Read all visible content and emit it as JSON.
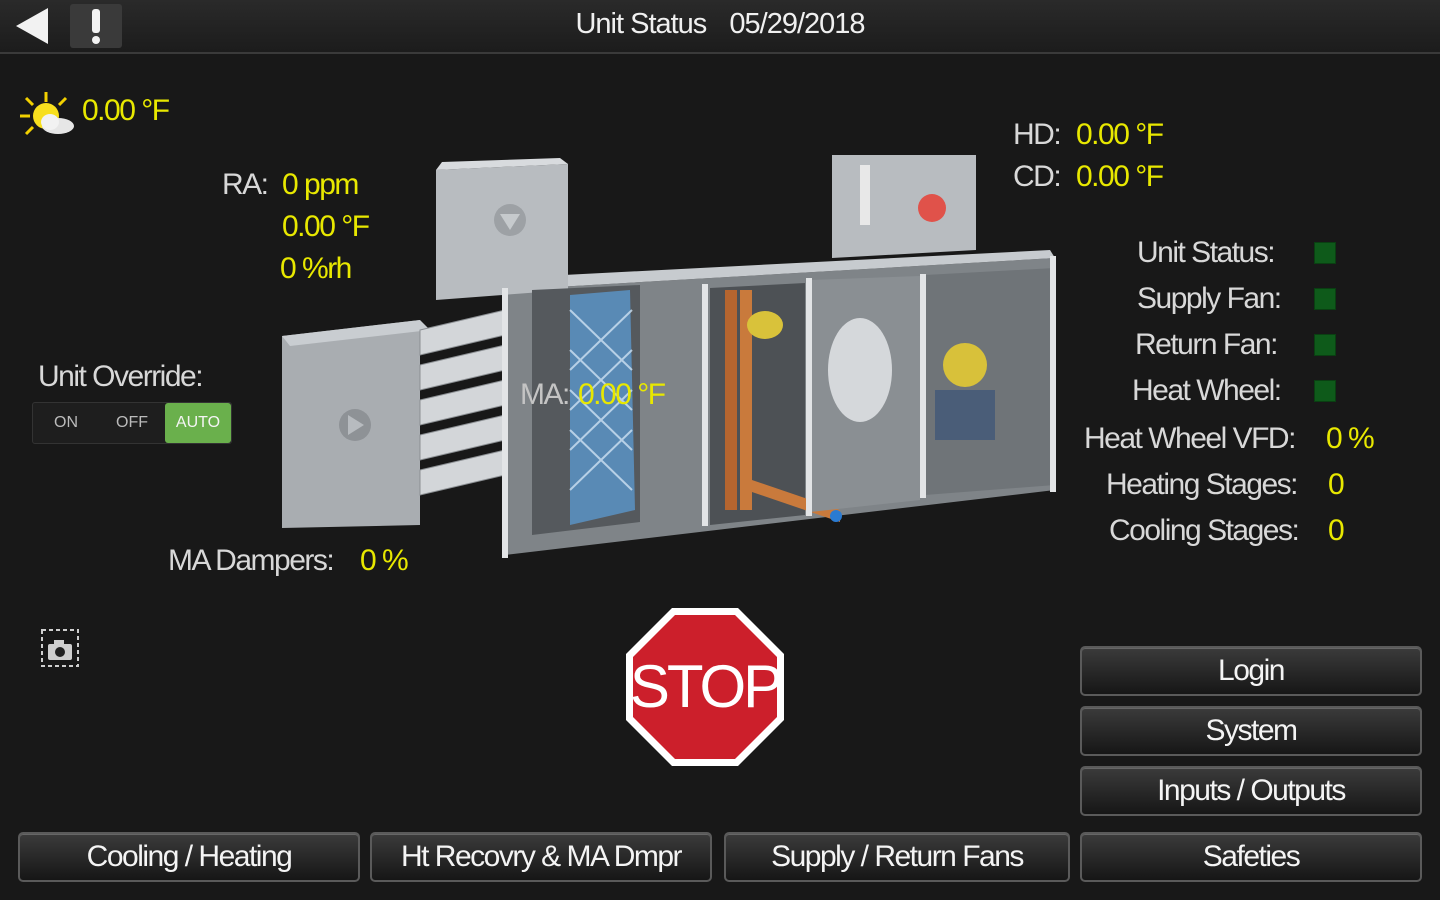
{
  "header": {
    "title": "Unit Status",
    "date": "05/29/2018"
  },
  "outdoor": {
    "temp": "0.00 °F",
    "icon": "sun-cloud-icon"
  },
  "ra": {
    "label": "RA:",
    "ppm": "0 ppm",
    "temp": "0.00 °F",
    "rh": "0 %rh"
  },
  "hd": {
    "label": "HD:",
    "value": "0.00 °F"
  },
  "cd": {
    "label": "CD:",
    "value": "0.00 °F"
  },
  "ma": {
    "label": "MA:",
    "value": "0.00 °F"
  },
  "override": {
    "label": "Unit Override:",
    "options": [
      "ON",
      "OFF",
      "AUTO"
    ],
    "selected": "AUTO"
  },
  "ma_dampers": {
    "label": "MA Dampers:",
    "value": "0 %"
  },
  "status": {
    "unit_status": "Unit Status:",
    "supply_fan": "Supply Fan:",
    "return_fan": "Return Fan:",
    "heat_wheel": "Heat Wheel:",
    "heat_wheel_vfd": {
      "label": "Heat Wheel VFD:",
      "value": "0 %"
    },
    "heating_stages": {
      "label": "Heating Stages:",
      "value": "0"
    },
    "cooling_stages": {
      "label": "Cooling Stages:",
      "value": "0"
    }
  },
  "stop": {
    "label": "STOP"
  },
  "buttons": {
    "login": "Login",
    "system": "System",
    "inputs_outputs": "Inputs / Outputs",
    "cooling_heating": "Cooling / Heating",
    "ht_recovery": "Ht Recovry & MA Dmpr",
    "supply_return": "Supply / Return Fans",
    "safeties": "Safeties"
  },
  "colors": {
    "value": "#e8e800",
    "led": "#0e5a1a",
    "auto": "#6ab04c",
    "stop": "#cc1f2b"
  }
}
